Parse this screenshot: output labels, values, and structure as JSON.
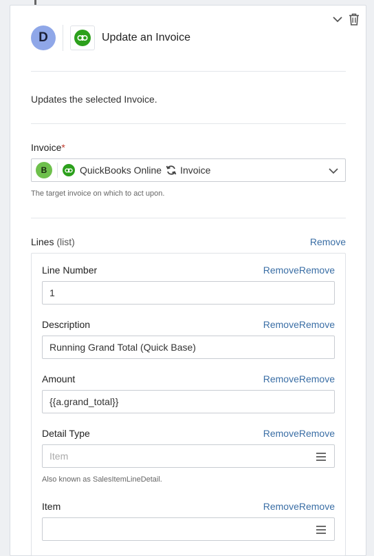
{
  "header": {
    "avatar_letter": "D",
    "title": "Update an Invoice"
  },
  "description": "Updates the selected Invoice.",
  "invoice_field": {
    "label": "Invoice",
    "required_mark": "*",
    "avatar_letter": "B",
    "app_name": "QuickBooks Online",
    "object_name": "Invoice",
    "help": "The target invoice on which to act upon."
  },
  "lines": {
    "label": "Lines",
    "type_hint": "(list)",
    "remove_label": "Remove",
    "items": [
      {
        "label": "Line Number",
        "remove": "RemoveRemove",
        "value": "1"
      },
      {
        "label": "Description",
        "remove": "RemoveRemove",
        "value": "Running Grand Total (Quick Base)"
      },
      {
        "label": "Amount",
        "remove": "RemoveRemove",
        "value": "{{a.grand_total}}"
      },
      {
        "label": "Detail Type",
        "remove": "RemoveRemove",
        "placeholder": "Item",
        "help": "Also known as SalesItemLineDetail."
      },
      {
        "label": "Item",
        "remove": "RemoveRemove",
        "value": ""
      }
    ]
  },
  "colors": {
    "accent_link": "#3a6ea5",
    "quickbooks_green": "#2ca01c",
    "avatar_d": "#8fa7e8",
    "avatar_b": "#6ec04c"
  },
  "icons": {
    "collapse": "chevron-down-icon",
    "delete": "trash-icon",
    "app": "quickbooks-icon",
    "sync": "sync-icon",
    "menu": "hamburger-icon"
  }
}
